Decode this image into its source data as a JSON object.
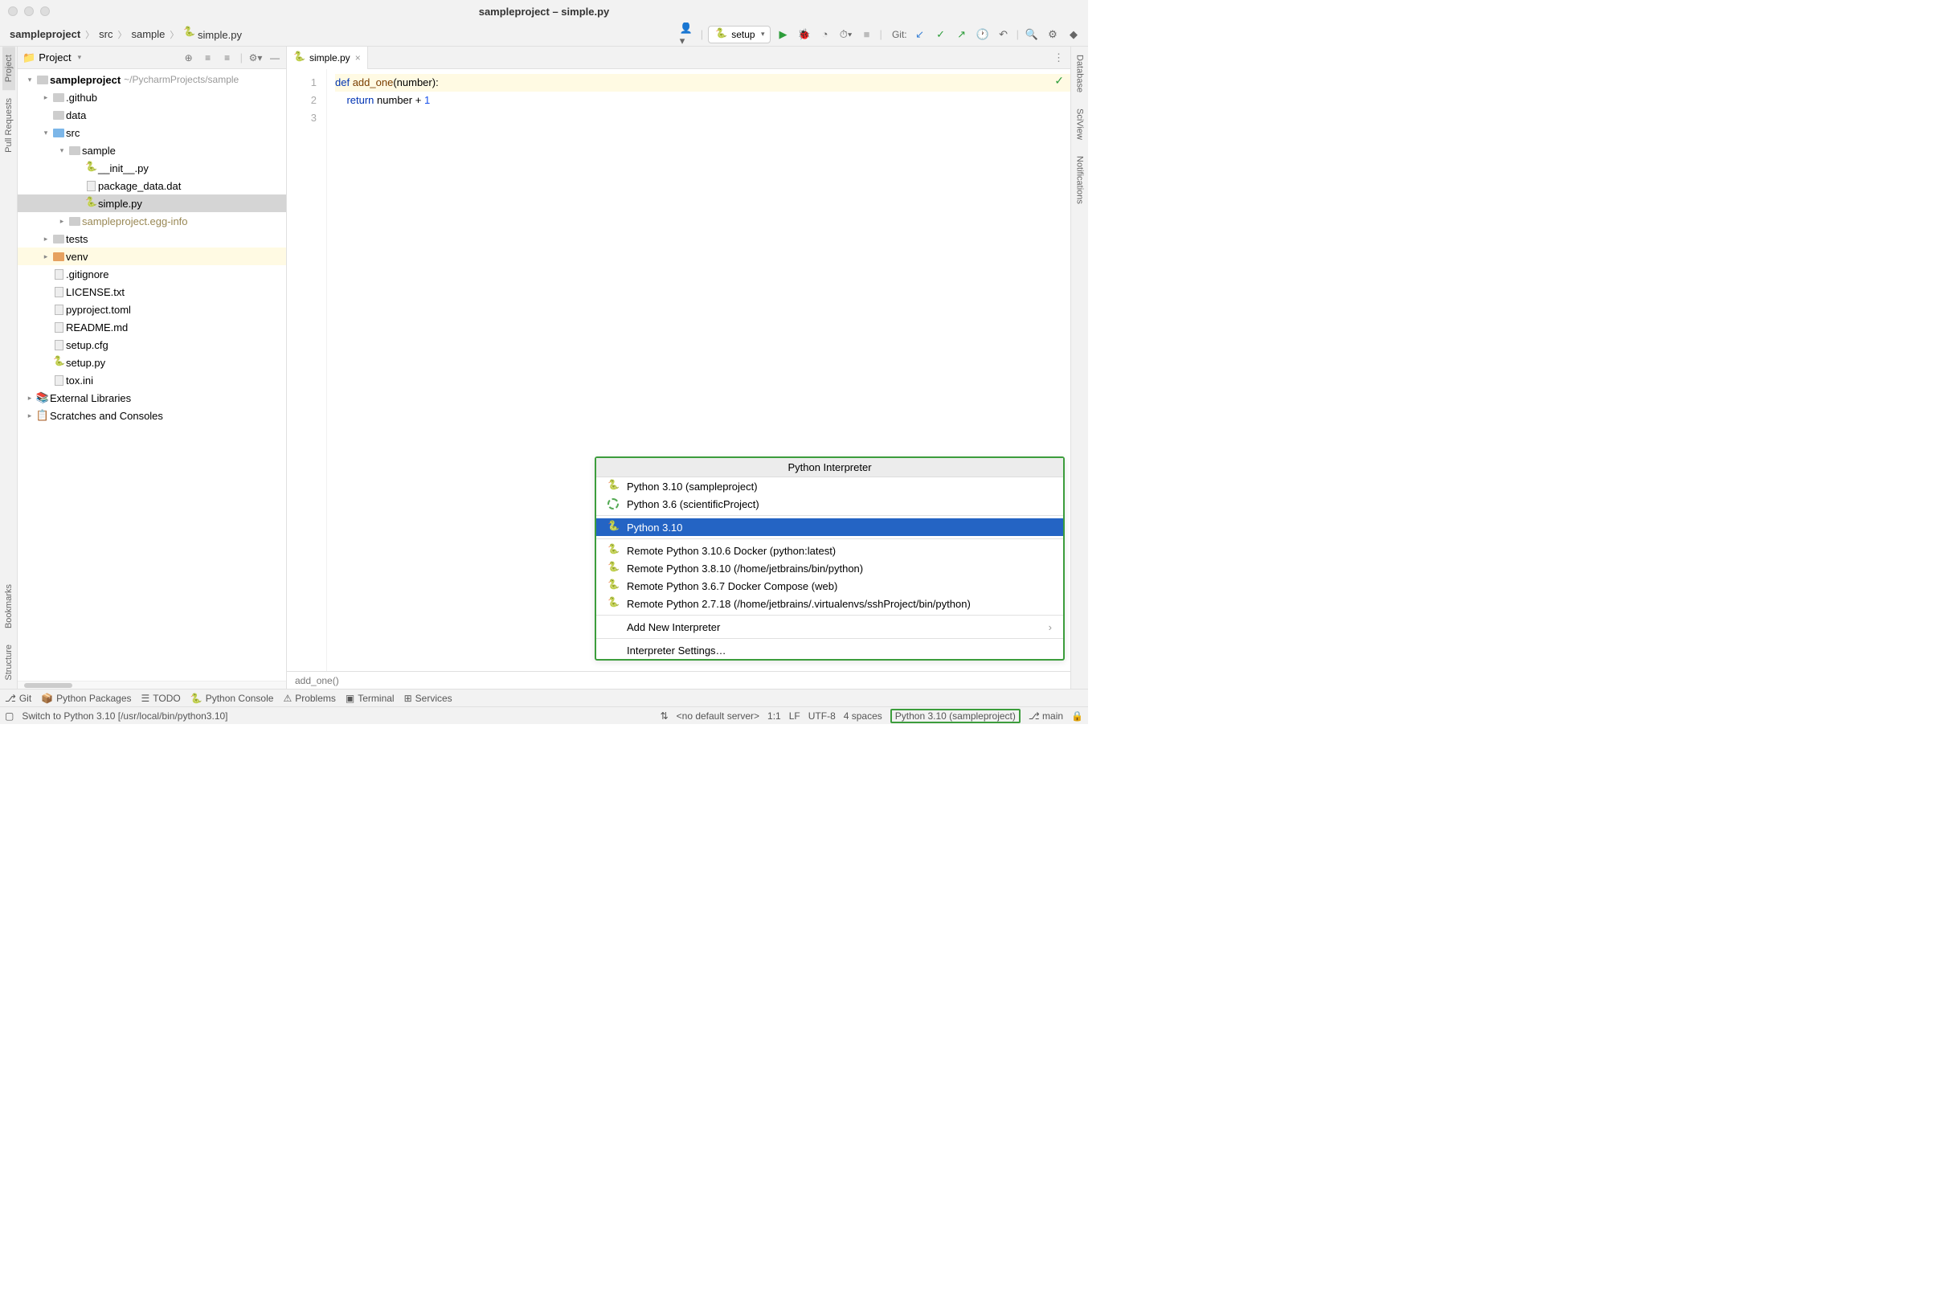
{
  "window": {
    "title": "sampleproject – simple.py"
  },
  "breadcrumbs": [
    "sampleproject",
    "src",
    "sample",
    "simple.py"
  ],
  "run_config": {
    "label": "setup"
  },
  "git_label": "Git:",
  "project_panel": {
    "title": "Project",
    "root": {
      "name": "sampleproject",
      "path": "~/PycharmProjects/sample"
    },
    "items": [
      {
        "name": ".github"
      },
      {
        "name": "data"
      },
      {
        "name": "src"
      },
      {
        "name": "sample"
      },
      {
        "name": "__init__.py"
      },
      {
        "name": "package_data.dat"
      },
      {
        "name": "simple.py"
      },
      {
        "name": "sampleproject.egg-info"
      },
      {
        "name": "tests"
      },
      {
        "name": "venv"
      },
      {
        "name": ".gitignore"
      },
      {
        "name": "LICENSE.txt"
      },
      {
        "name": "pyproject.toml"
      },
      {
        "name": "README.md"
      },
      {
        "name": "setup.cfg"
      },
      {
        "name": "setup.py"
      },
      {
        "name": "tox.ini"
      },
      {
        "name": "External Libraries"
      },
      {
        "name": "Scratches and Consoles"
      }
    ]
  },
  "editor": {
    "tab": "simple.py",
    "lines": [
      "1",
      "2",
      "3"
    ],
    "code": {
      "def": "def",
      "fn": "add_one",
      "params": "(number):",
      "return": "return",
      "expr": " number + ",
      "one": "1"
    },
    "breadcrumb": "add_one()"
  },
  "interpreter_popup": {
    "title": "Python Interpreter",
    "items": [
      "Python 3.10 (sampleproject)",
      "Python 3.6 (scientificProject)",
      "Python 3.10",
      "Remote Python 3.10.6 Docker (python:latest)",
      "Remote Python 3.8.10 (/home/jetbrains/bin/python)",
      "Remote Python 3.6.7 Docker Compose (web)",
      "Remote Python 2.7.18 (/home/jetbrains/.virtualenvs/sshProject/bin/python)",
      "Add New Interpreter",
      "Interpreter Settings…"
    ]
  },
  "left_gutter": [
    "Project",
    "Pull Requests",
    "Bookmarks",
    "Structure"
  ],
  "right_gutter": [
    "Database",
    "SciView",
    "Notifications"
  ],
  "bottom_bar": [
    "Git",
    "Python Packages",
    "TODO",
    "Python Console",
    "Problems",
    "Terminal",
    "Services"
  ],
  "status_bar": {
    "left": "Switch to Python 3.10 [/usr/local/bin/python3.10]",
    "server": "<no default server>",
    "pos": "1:1",
    "le": "LF",
    "enc": "UTF-8",
    "indent": "4 spaces",
    "interpreter": "Python 3.10 (sampleproject)",
    "branch": "main"
  }
}
